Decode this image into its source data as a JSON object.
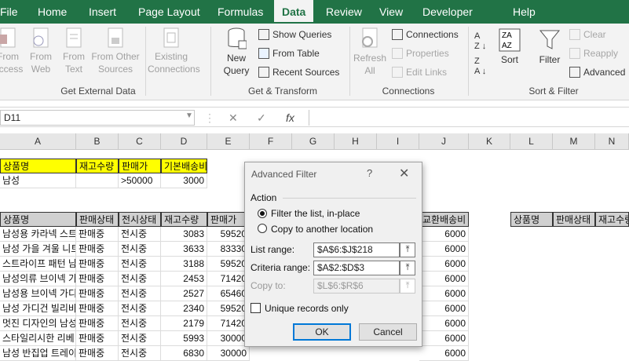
{
  "tabs": [
    "File",
    "Home",
    "Insert",
    "Page Layout",
    "Formulas",
    "Data",
    "Review",
    "View",
    "Developer",
    "Help"
  ],
  "ribbon": {
    "get_external": {
      "group": "Get External Data",
      "from_access": "From Access",
      "from_web": "From Web",
      "from_text": "From Text",
      "from_other": "From Other Sources",
      "existing": "Existing Connections"
    },
    "get_transform": {
      "group": "Get & Transform",
      "new_query": "New Query",
      "show_queries": "Show Queries",
      "from_table": "From Table",
      "recent_sources": "Recent Sources"
    },
    "connections": {
      "group": "Connections",
      "refresh_all": "Refresh All",
      "connections": "Connections",
      "properties": "Properties",
      "edit_links": "Edit Links"
    },
    "sort_filter": {
      "group": "Sort & Filter",
      "sort": "Sort",
      "filter": "Filter",
      "clear": "Clear",
      "reapply": "Reapply",
      "advanced": "Advanced"
    }
  },
  "formula_bar": {
    "name_box": "D11",
    "fx": "fx"
  },
  "columns": [
    "A",
    "B",
    "C",
    "D",
    "E",
    "F",
    "G",
    "H",
    "I",
    "J",
    "K",
    "L",
    "M",
    "N"
  ],
  "criteria": {
    "headers": [
      "상품명",
      "재고수량",
      "판매가",
      "기본배송비"
    ],
    "row": [
      "남성",
      "",
      ">50000",
      "3000"
    ]
  },
  "table_headers": [
    "상품명",
    "판매상태",
    "전시상태",
    "재고수량",
    "판매가"
  ],
  "extra_header_j": "교환배송비",
  "output_headers": [
    "상품명",
    "판매상태",
    "재고수량"
  ],
  "rows": [
    {
      "a": "남성용 카라넥 스트",
      "b": "판매중",
      "c": "전시중",
      "d": "3083",
      "e": "59520",
      "j": "6000"
    },
    {
      "a": "남성 가을 겨울 니트",
      "b": "판매중",
      "c": "전시중",
      "d": "3633",
      "e": "83330",
      "j": "6000"
    },
    {
      "a": "스트라이프 패턴 남",
      "b": "판매중",
      "c": "전시중",
      "d": "3188",
      "e": "59520",
      "j": "6000"
    },
    {
      "a": "남성의류 브이넥 가",
      "b": "판매중",
      "c": "전시중",
      "d": "2453",
      "e": "71420",
      "j": "6000"
    },
    {
      "a": "남성용 브이넥 가디",
      "b": "판매중",
      "c": "전시중",
      "d": "2527",
      "e": "65460",
      "j": "6000"
    },
    {
      "a": "남성 가디건 빌리바",
      "b": "판매중",
      "c": "전시중",
      "d": "2340",
      "e": "59520",
      "j": "6000"
    },
    {
      "a": "멋진 디자인의 남성",
      "b": "판매중",
      "c": "전시중",
      "d": "2179",
      "e": "71420",
      "j": "6000"
    },
    {
      "a": "스타일리시한 리베",
      "b": "판매중",
      "c": "전시중",
      "d": "5993",
      "e": "30000",
      "j": "6000"
    },
    {
      "a": "남성 반집업 트레이",
      "b": "판매중",
      "c": "전시중",
      "d": "6830",
      "e": "30000",
      "j": "6000"
    }
  ],
  "dialog": {
    "title": "Advanced Filter",
    "help": "?",
    "close": "✕",
    "action": "Action",
    "opt_inplace": "Filter the list, in-place",
    "opt_copy": "Copy to another location",
    "list_range_label": "List range:",
    "list_range": "$A$6:$J$218",
    "criteria_label": "Criteria range:",
    "criteria_range": "$A$2:$D$3",
    "copy_to_label": "Copy to:",
    "copy_to": "$L$6:$R$6",
    "unique": "Unique records only",
    "ok": "OK",
    "cancel": "Cancel"
  }
}
